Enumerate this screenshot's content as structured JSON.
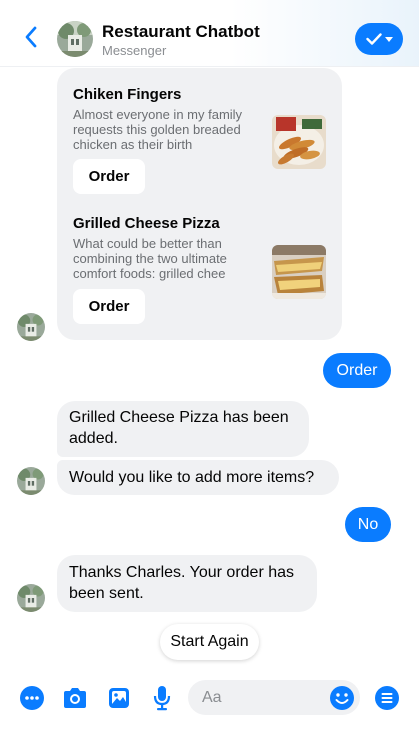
{
  "header": {
    "title": "Restaurant Chatbot",
    "subtitle": "Messenger"
  },
  "card": {
    "items": [
      {
        "title": "Chiken Fingers",
        "desc_lines": [
          "Almost everyone in my family",
          "requests this golden breaded",
          "chicken as their birth"
        ],
        "button": "Order",
        "image_icon": "chicken-fingers-image"
      },
      {
        "title": "Grilled Cheese Pizza",
        "desc_lines": [
          "What could be better than",
          "combining the two ultimate",
          "comfort foods: grilled chee"
        ],
        "button": "Order",
        "image_icon": "grilled-cheese-pizza-image"
      }
    ]
  },
  "messages": {
    "user_order": "Order",
    "bot_added_lines": [
      "Grilled Cheese Pizza has been",
      "added."
    ],
    "bot_more": "Would you like to add more items?",
    "user_no": "No",
    "bot_sent_lines": [
      "Thanks Charles. Your order has",
      "been sent."
    ]
  },
  "quick_reply": "Start Again",
  "composer": {
    "placeholder": "Aa",
    "icons": [
      "more-icon",
      "camera-icon",
      "gallery-icon",
      "microphone-icon",
      "emoji-icon",
      "menu-icon"
    ]
  },
  "colors": {
    "accent": "#0a7cff",
    "bubble_gray": "#f0f1f3",
    "text": "#050505",
    "muted": "#8a8d91"
  }
}
